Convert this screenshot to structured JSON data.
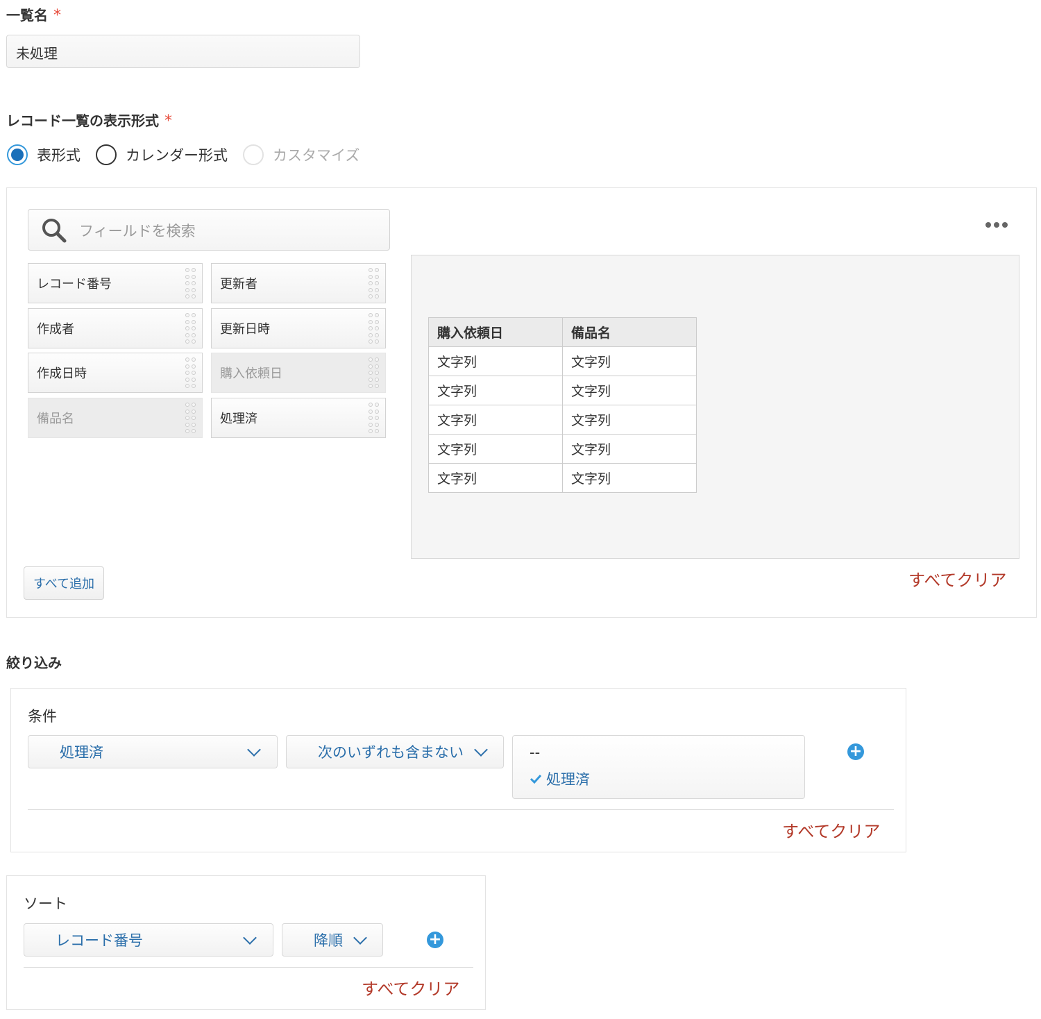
{
  "list_name": {
    "label": "一覧名",
    "required_mark": "*",
    "value": "未処理"
  },
  "display_format": {
    "label": "レコード一覧の表示形式",
    "required_mark": "*",
    "options": [
      {
        "label": "表形式",
        "state": "checked"
      },
      {
        "label": "カレンダー形式",
        "state": "unchecked"
      },
      {
        "label": "カスタマイズ",
        "state": "disabled"
      }
    ]
  },
  "field_palette": {
    "search_placeholder": "フィールドを検索",
    "items": [
      {
        "label": "レコード番号",
        "used": false
      },
      {
        "label": "更新者",
        "used": false
      },
      {
        "label": "作成者",
        "used": false
      },
      {
        "label": "更新日時",
        "used": false
      },
      {
        "label": "作成日時",
        "used": false
      },
      {
        "label": "購入依頼日",
        "used": true
      },
      {
        "label": "備品名",
        "used": true
      },
      {
        "label": "処理済",
        "used": false
      }
    ],
    "add_all_label": "すべて追加"
  },
  "preview": {
    "columns": [
      "購入依頼日",
      "備品名"
    ],
    "rows": [
      [
        "文字列",
        "文字列"
      ],
      [
        "文字列",
        "文字列"
      ],
      [
        "文字列",
        "文字列"
      ],
      [
        "文字列",
        "文字列"
      ],
      [
        "文字列",
        "文字列"
      ]
    ],
    "clear_all_label": "すべてクリア"
  },
  "filter": {
    "title": "絞り込み",
    "condition_label": "条件",
    "field_select": "処理済",
    "operator_select": "次のいずれも含まない",
    "value_options": [
      {
        "label": "--",
        "checked": false
      },
      {
        "label": "処理済",
        "checked": true
      }
    ],
    "clear_all_label": "すべてクリア"
  },
  "sort": {
    "label": "ソート",
    "field_select": "レコード番号",
    "order_select": "降順",
    "clear_all_label": "すべてクリア"
  },
  "colors": {
    "accent": "#3498db",
    "link": "#2a6eaa",
    "danger": "#b33a2a",
    "required": "#e74c3c"
  }
}
